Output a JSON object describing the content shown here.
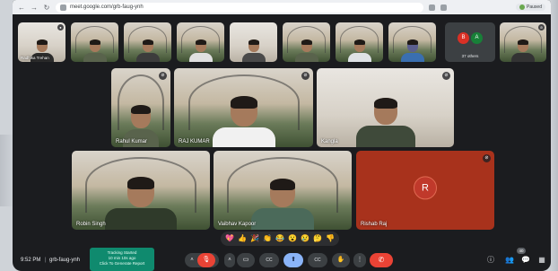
{
  "browser": {
    "nav": [
      "←",
      "→",
      "↻"
    ],
    "url": "meet.google.com/grb-faug-ynh",
    "profile_label": "Paused"
  },
  "top_strip": [
    {
      "name": "Radhika Trehan",
      "kind": "indoor"
    },
    {
      "name": "",
      "kind": "outdoor"
    },
    {
      "name": "",
      "kind": "outdoor"
    },
    {
      "name": "",
      "kind": "outdoor"
    },
    {
      "name": "",
      "kind": "indoor"
    },
    {
      "name": "",
      "kind": "outdoor"
    },
    {
      "name": "",
      "kind": "outdoor"
    },
    {
      "name": "",
      "kind": "outdoor"
    },
    {
      "name": "",
      "kind": "outdoor"
    }
  ],
  "others": {
    "avatars": [
      "B",
      "A"
    ],
    "avatar_colors": [
      "#d93025",
      "#188038"
    ],
    "label": "37 others"
  },
  "top_right_tile": {
    "name": ""
  },
  "middle_row": [
    {
      "name": "Rahul Kumar"
    },
    {
      "name": "RAJ KUMAR"
    },
    {
      "name": "Kangla"
    }
  ],
  "bottom_row": [
    {
      "name": "Robin Singh"
    },
    {
      "name": "Vaibhav Kapoor"
    },
    {
      "name": "Rishab Raj",
      "avatar_letter": "R",
      "tile_color": "#a8321c"
    }
  ],
  "reactions": [
    "💖",
    "👍",
    "🎉",
    "👏",
    "😂",
    "😮",
    "😢",
    "🤔",
    "👎"
  ],
  "meeting": {
    "time": "9:52 PM",
    "divider": "|",
    "code": "grb-faug-ynh"
  },
  "tracking": {
    "line1": "Tracking Started",
    "line2": "10 min 10s ago",
    "line3": "Click To Generate Report"
  },
  "controls": {
    "caret": "˄",
    "mic": "🎙",
    "cam_caret": "˄",
    "camera": "▭",
    "captions": "CC",
    "share": "⬆",
    "raise_hand": "✋",
    "more": "⋮",
    "hangup": "✆"
  },
  "right_tools": {
    "info": "ⓘ",
    "people": "👥",
    "people_count": "40",
    "chat": "💬",
    "activities": "▦"
  }
}
